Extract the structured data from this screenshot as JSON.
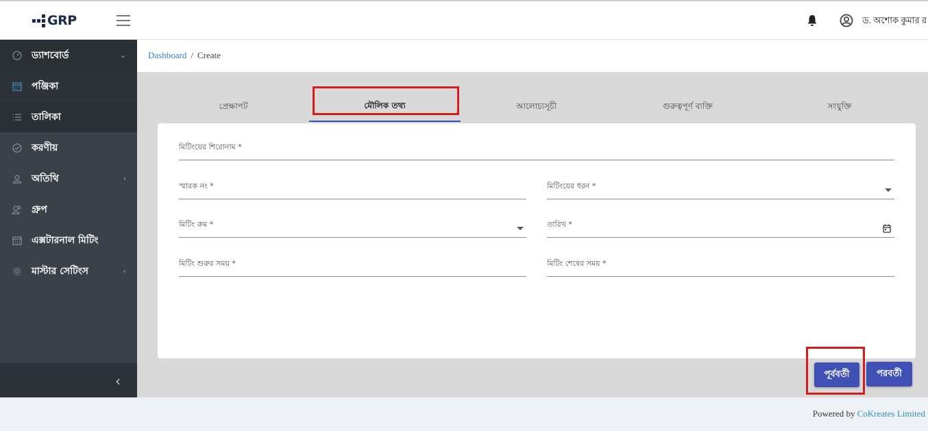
{
  "header": {
    "logo_text": "GRP",
    "user_name": "ড. অশোক কুমার র"
  },
  "sidebar": {
    "items": [
      {
        "label": "ড্যাশবোর্ড",
        "icon": "dashboard-gauge-icon",
        "chevron": "⌄"
      },
      {
        "label": "পঞ্জিকা",
        "icon": "calendar-icon",
        "chevron": ""
      },
      {
        "label": "তালিকা",
        "icon": "list-icon",
        "chevron": ""
      },
      {
        "label": "করণীয়",
        "icon": "check-circle-icon",
        "chevron": ""
      },
      {
        "label": "অতিথি",
        "icon": "user-icon",
        "chevron": "‹"
      },
      {
        "label": "গ্রুপ",
        "icon": "group-icon",
        "chevron": ""
      },
      {
        "label": "এক্সটারনাল মিটিং",
        "icon": "calendar-grid-icon",
        "chevron": ""
      },
      {
        "label": "মাস্টার সেটিংস",
        "icon": "gear-icon",
        "chevron": "‹"
      }
    ],
    "collapse_glyph": "‹"
  },
  "breadcrumb": {
    "home": "Dashboard",
    "separator": "/",
    "current": "Create"
  },
  "tabs": [
    {
      "label": "প্রেক্ষাপট",
      "active": false
    },
    {
      "label": "মৌলিক তথ্য",
      "active": true
    },
    {
      "label": "আলোচ্যসূচী",
      "active": false
    },
    {
      "label": "গুরুত্বপূর্ণ ব্যক্তি",
      "active": false
    },
    {
      "label": "সংযুক্তি",
      "active": false
    }
  ],
  "form": {
    "meeting_title": "মিটিংয়ের শিরোনাম  *",
    "memo_no": "স্মারক নং *",
    "meeting_type": "মিটিংয়ের ধরন *",
    "meeting_room": "মিটিং রুম *",
    "date": "তারিখ *",
    "start_time": "মিটিং শুরুর সময়  *",
    "end_time": "মিটিং শেষের সময়  *"
  },
  "buttons": {
    "previous": "পূর্ববর্তী",
    "next": "পরবর্তী"
  },
  "footer": {
    "powered_by": "Powered by",
    "company": "CoKreates Limited"
  },
  "colors": {
    "sidebar_bg": "#3b4148",
    "accent": "#3f51b5",
    "highlight": "#d31c1c",
    "link": "#3a7bbf"
  }
}
